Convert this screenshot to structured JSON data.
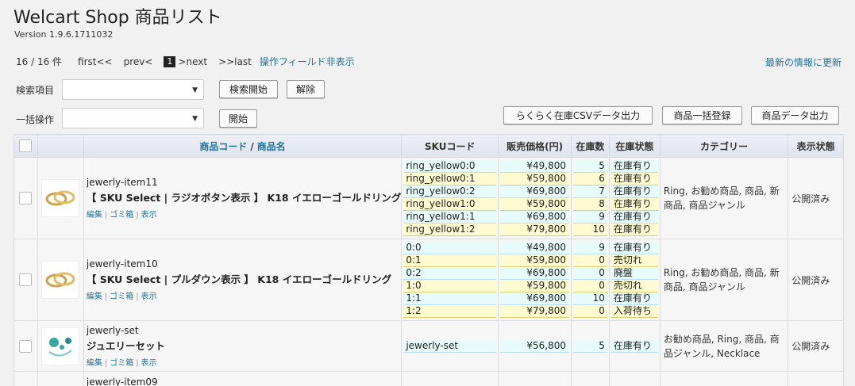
{
  "header": {
    "title": "Welcart Shop 商品リスト",
    "version": "Version 1.9.6.1711032"
  },
  "pager": {
    "count": "16 / 16 件",
    "first": "first<<",
    "prev": "prev<",
    "current": "1",
    "next": ">next",
    "last": ">>last",
    "toggle": "操作フィールド非表示"
  },
  "refresh": "最新の情報に更新",
  "search": {
    "label": "検索項目",
    "value": "",
    "start": "検索開始",
    "clear": "解除"
  },
  "bulk": {
    "label": "一括操作",
    "value": "",
    "start": "開始"
  },
  "exports": {
    "csv": "らくらく在庫CSVデータ出力",
    "register": "商品一括登録",
    "export": "商品データ出力"
  },
  "columns": {
    "code": "商品コード",
    "sep": "/",
    "name": "商品名",
    "sku": "SKUコード",
    "price": "販売価格(円)",
    "stock": "在庫数",
    "status": "在庫状態",
    "category": "カテゴリー",
    "display": "表示状態"
  },
  "row_actions": {
    "edit": "編集",
    "trash": "ゴミ箱",
    "view": "表示"
  },
  "products": [
    {
      "code": "jewerly-item11",
      "name": "【 SKU Select | ラジオボタン表示 】 K18 イエローゴールドリング",
      "skus": [
        {
          "code": "ring_yellow0:0",
          "price": "¥49,800",
          "stock": "5",
          "status": "在庫有り"
        },
        {
          "code": "ring_yellow0:1",
          "price": "¥59,800",
          "stock": "6",
          "status": "在庫有り"
        },
        {
          "code": "ring_yellow0:2",
          "price": "¥69,800",
          "stock": "7",
          "status": "在庫有り"
        },
        {
          "code": "ring_yellow1:0",
          "price": "¥59,800",
          "stock": "8",
          "status": "在庫有り"
        },
        {
          "code": "ring_yellow1:1",
          "price": "¥69,800",
          "stock": "9",
          "status": "在庫有り"
        },
        {
          "code": "ring_yellow1:2",
          "price": "¥79,800",
          "stock": "10",
          "status": "在庫有り"
        }
      ],
      "category": "Ring, お勧め商品, 商品, 新商品, 商品ジャンル",
      "display": "公開済み"
    },
    {
      "code": "jewerly-item10",
      "name": "【 SKU Select | プルダウン表示 】 K18 イエローゴールドリング",
      "skus": [
        {
          "code": "0:0",
          "price": "¥49,800",
          "stock": "9",
          "status": "在庫有り"
        },
        {
          "code": "0:1",
          "price": "¥59,800",
          "stock": "0",
          "status": "売切れ"
        },
        {
          "code": "0:2",
          "price": "¥69,800",
          "stock": "0",
          "status": "廃盤"
        },
        {
          "code": "1:0",
          "price": "¥59,800",
          "stock": "0",
          "status": "売切れ"
        },
        {
          "code": "1:1",
          "price": "¥69,800",
          "stock": "10",
          "status": "在庫有り"
        },
        {
          "code": "1:2",
          "price": "¥79,800",
          "stock": "0",
          "status": "入荷待ち"
        }
      ],
      "category": "Ring, お勧め商品, 商品, 新商品, 商品ジャンル",
      "display": "公開済み"
    },
    {
      "code": "jewerly-set",
      "name": "ジュエリーセット",
      "skus": [
        {
          "code": "jewerly-set",
          "price": "¥56,800",
          "stock": "5",
          "status": "在庫有り"
        }
      ],
      "category": "お勧め商品, Ring, 商品, 商品ジャンル, Necklace",
      "display": "公開済み"
    },
    {
      "code": "jewerly-item09",
      "name": "",
      "skus": [],
      "category": "",
      "display": ""
    }
  ]
}
